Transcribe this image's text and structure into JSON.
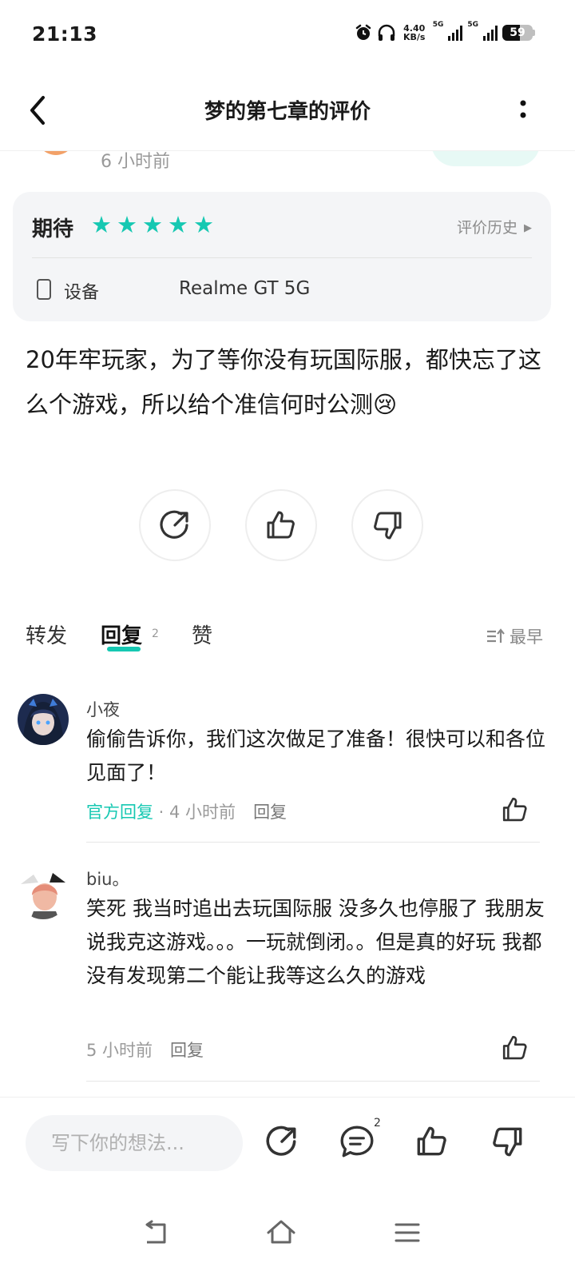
{
  "status_bar": {
    "time": "21:13",
    "speed_value": "4.40",
    "speed_unit": "KB/s",
    "net1": "5G",
    "net2": "5G",
    "battery": "59"
  },
  "header": {
    "title": "梦的第七章的评价"
  },
  "peek": {
    "time": "6 小时前"
  },
  "rating_card": {
    "label": "期待",
    "stars": 5,
    "history_label": "评价历史",
    "device_label": "设备",
    "device_name": "Realme GT 5G"
  },
  "review": {
    "text": "20年牢玩家，为了等你没有玩国际服，都快忘了这么个游戏，所以给个准信何时公测😢"
  },
  "tabs": {
    "forward": "转发",
    "replies": "回复",
    "reply_count": "2",
    "likes": "赞",
    "sort": "最早"
  },
  "replies": [
    {
      "name": "小夜",
      "text": "偷偷告诉你，我们这次做足了准备！很快可以和各位见面了！",
      "official": "官方回复",
      "time": " · 4 小时前",
      "reply": "回复"
    },
    {
      "name": "biu。",
      "text": "笑死 我当时追出去玩国际服 没多久也停服了 我朋友说我克这游戏。。。一玩就倒闭。。但是真的好玩 我都没有发现第二个能让我等这么久的游戏",
      "time": "5 小时前",
      "reply": "回复"
    }
  ],
  "bottom_bar": {
    "placeholder": "写下你的想法...",
    "comment_count": "2"
  },
  "colors": {
    "accent": "#16c8b2",
    "card_bg": "#f4f5f7",
    "muted": "#999999"
  }
}
